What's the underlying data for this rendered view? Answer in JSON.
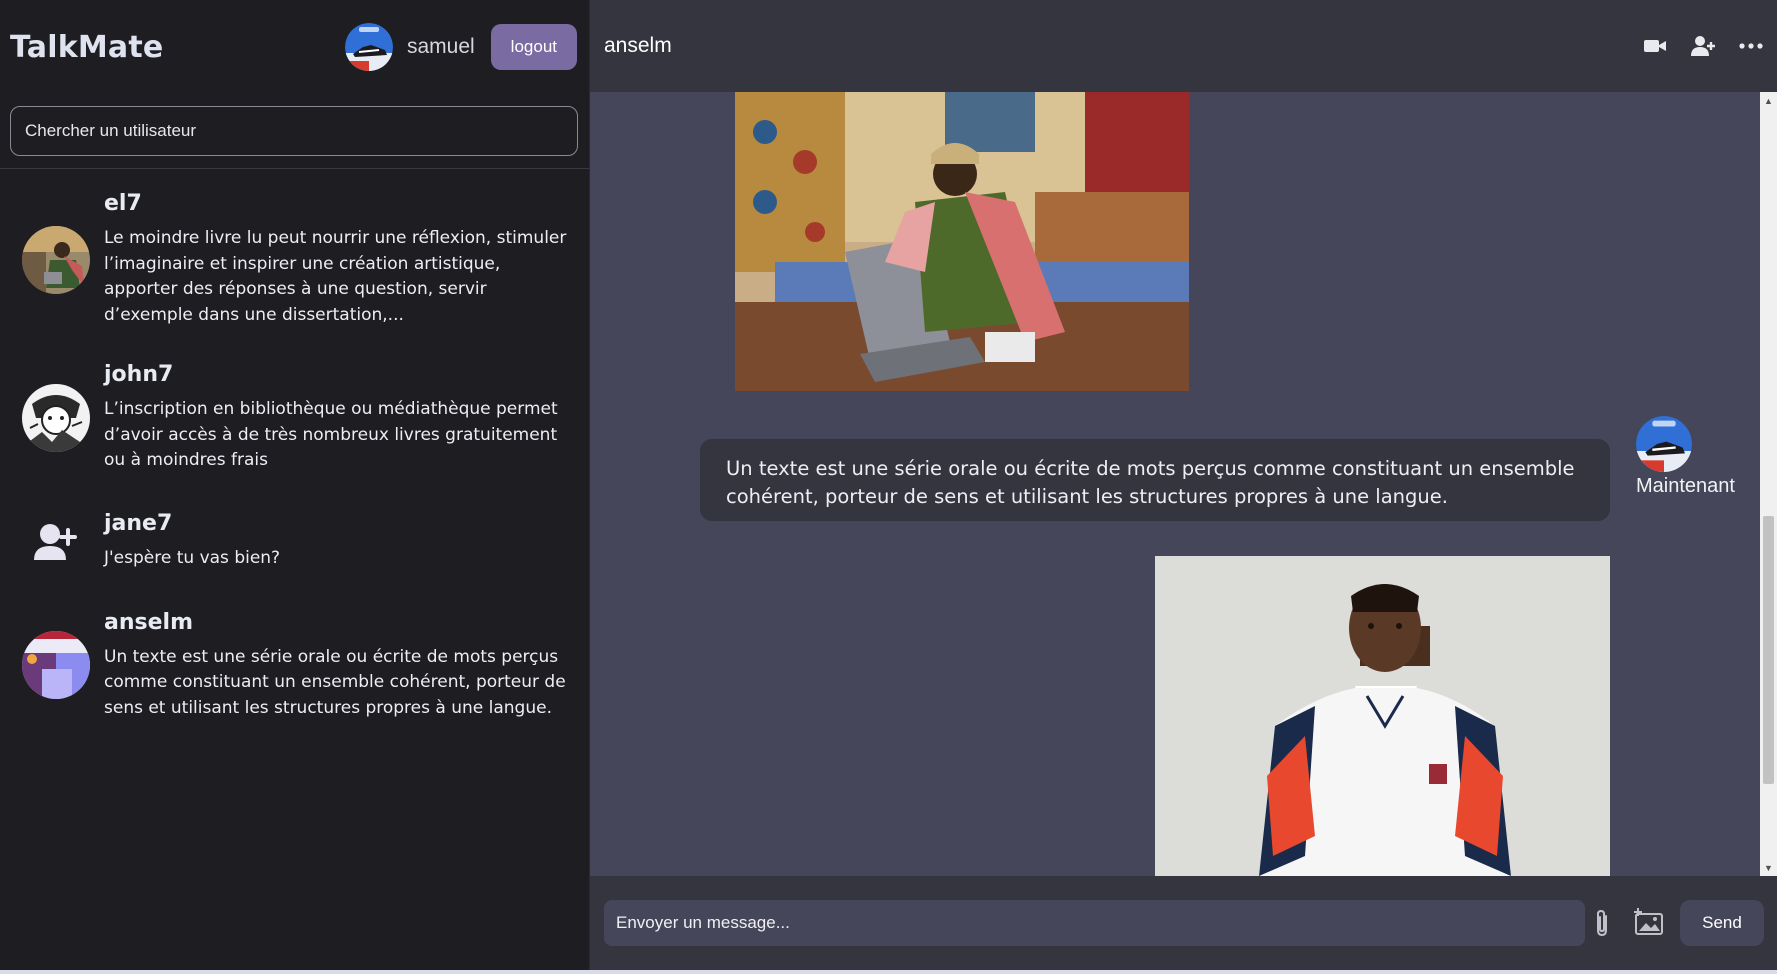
{
  "sidebar": {
    "brand": "TalkMate",
    "current_user": {
      "name": "samuel",
      "avatar": "sneaker-avatar"
    },
    "logout_label": "logout",
    "search": {
      "placeholder": "Chercher un utilisateur",
      "value": ""
    },
    "contacts": [
      {
        "name": "el7",
        "avatar": "photo-avatar",
        "last_message": "Le moindre livre lu peut nourrir une réflexion, stimuler l’imaginaire et inspirer une création artistique, apporter des réponses à une question, servir d’exemple dans une dissertation,..."
      },
      {
        "name": "john7",
        "avatar": "manga-avatar",
        "last_message": "L’inscription en bibliothèque ou médiathèque permet d’avoir accès à de très nombreux livres gratuitement ou à moindres frais"
      },
      {
        "name": "jane7",
        "avatar": "default-user-icon",
        "last_message": "J'espère tu vas bien?"
      },
      {
        "name": "anselm",
        "avatar": "colorful-avatar",
        "last_message": "Un texte est une série orale ou écrite de mots perçus comme constituant un ensemble cohérent, porteur de sens et utilisant les structures propres à une langue."
      }
    ]
  },
  "chat": {
    "title": "anselm",
    "header_icons": [
      "video-camera-icon",
      "add-user-icon",
      "more-options-icon"
    ],
    "messages": [
      {
        "type": "image",
        "content": "man-with-laptop-photo"
      },
      {
        "type": "text",
        "text": "Un texte est une série orale ou écrite de mots perçus comme constituant un ensemble cohérent, porteur de sens et utilisant les structures propres à une langue.",
        "time": "Maintenant"
      },
      {
        "type": "image",
        "content": "portrait-photo"
      }
    ],
    "composer": {
      "placeholder": "Envoyer un message...",
      "value": "",
      "send_label": "Send"
    }
  },
  "colors": {
    "sidebar_bg": "#1e1e22",
    "chat_bg": "#46465a",
    "header_bg": "#35353f",
    "accent": "#7a6ba3"
  }
}
